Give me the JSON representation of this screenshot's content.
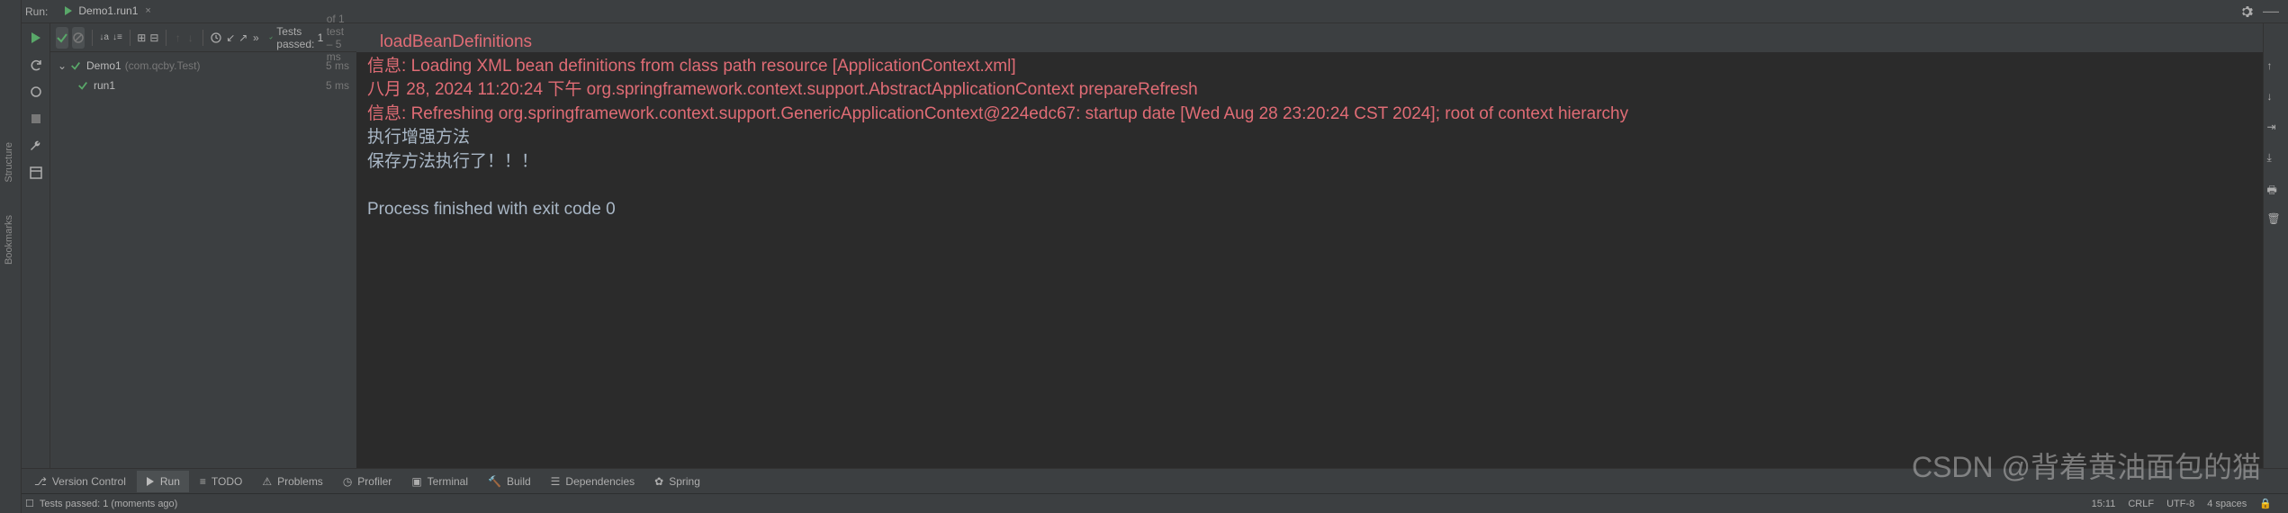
{
  "header": {
    "run_label": "Run:",
    "tab_name": "Demo1.run1"
  },
  "toolbar": {
    "tests_label": "Tests passed:",
    "tests_count": "1",
    "tests_of": "of 1 test – 5 ms"
  },
  "tree": {
    "root_name": "Demo1",
    "root_extra": "(com.qcby.Test)",
    "root_time": "5 ms",
    "child_name": "run1",
    "child_time": "5 ms"
  },
  "console": {
    "line1": "loadBeanDefinitions",
    "line2_prefix": "信息: ",
    "line2_text": "Loading XML bean definitions from class path resource [ApplicationContext.xml]",
    "line3": "八月 28, 2024 11:20:24 下午 org.springframework.context.support.AbstractApplicationContext prepareRefresh",
    "line4_prefix": "信息: ",
    "line4_text": "Refreshing org.springframework.context.support.GenericApplicationContext@224edc67: startup date [Wed Aug 28 23:20:24 CST 2024]; root of context hierarchy",
    "line5": "执行增强方法",
    "line6": "保存方法执行了！！！",
    "line7": "Process finished with exit code 0"
  },
  "bottom_tabs": {
    "version_control": "Version Control",
    "run": "Run",
    "todo": "TODO",
    "problems": "Problems",
    "profiler": "Profiler",
    "terminal": "Terminal",
    "build": "Build",
    "dependencies": "Dependencies",
    "spring": "Spring"
  },
  "status": {
    "left": "Tests passed: 1 (moments ago)",
    "pos": "15:11",
    "crlf": "CRLF",
    "encoding": "UTF-8",
    "indent": "4 spaces"
  },
  "watermark": "CSDN @背着黄油面包的猫"
}
